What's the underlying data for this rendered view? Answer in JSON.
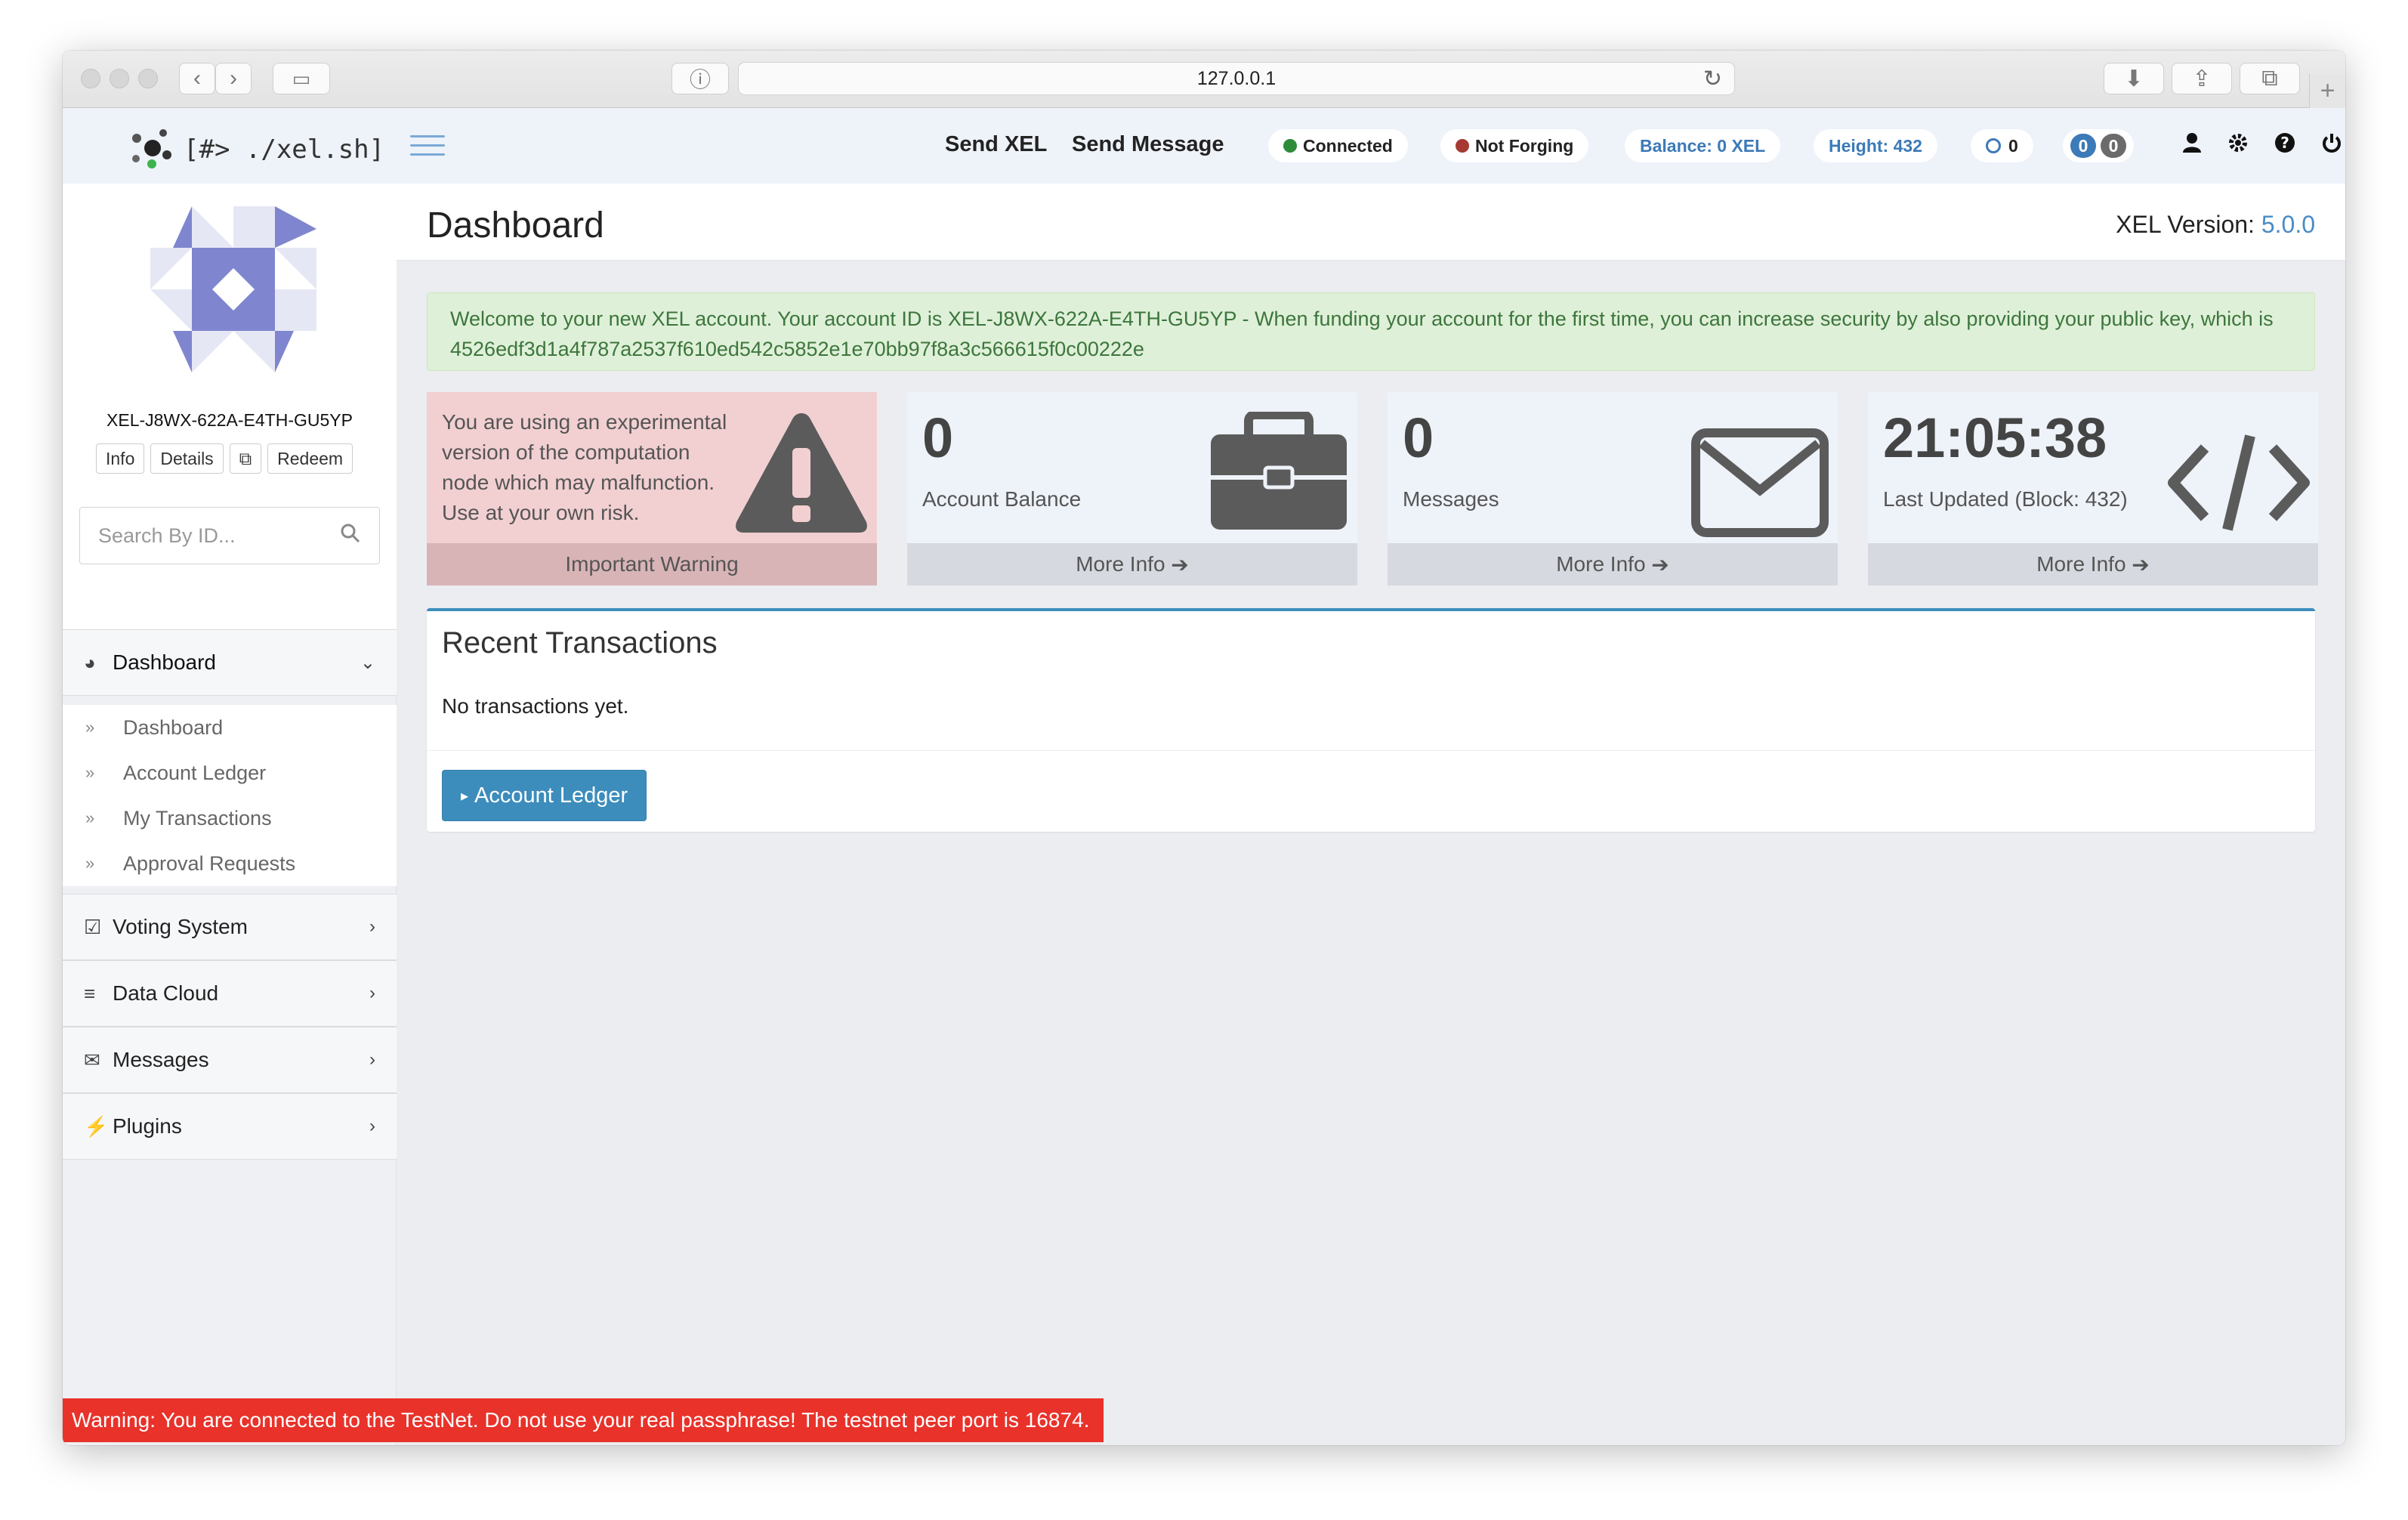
{
  "browser": {
    "url": "127.0.0.1"
  },
  "navbar": {
    "logo_text": "[#> ./xel.sh]",
    "send_xel": "Send XEL",
    "send_message": "Send Message",
    "connected": "Connected",
    "forging": "Not Forging",
    "balance": "Balance: 0 XEL",
    "height": "Height: 432",
    "pending_count": "0",
    "badge_left": "0",
    "badge_right": "0",
    "colors": {
      "connected": "#2e8b3a",
      "not_forging": "#a63a32",
      "badge_blue": "#3c7ab8",
      "badge_gray": "#6b6b6b"
    }
  },
  "sidebar": {
    "account_id": "XEL-J8WX-622A-E4TH-GU5YP",
    "buttons": [
      "Info",
      "Details",
      "⧉",
      "Redeem"
    ],
    "search_placeholder": "Search By ID...",
    "dashboard_head": "Dashboard",
    "dashboard_items": [
      "Dashboard",
      "Account Ledger",
      "My Transactions",
      "Approval Requests"
    ],
    "sections": [
      "Voting System",
      "Data Cloud",
      "Messages",
      "Plugins"
    ]
  },
  "content": {
    "title": "Dashboard",
    "version_label": "XEL Version:",
    "version_value": "5.0.0",
    "alert": "Welcome to your new XEL account. Your account ID is XEL-J8WX-622A-E4TH-GU5YP - When funding your account for the first time, you can increase security by also providing your public key, which is 4526edf3d1a4f787a2537f610ed542c5852e1e70bb97f8a3c566615f0c00222e",
    "warning_text": "You are using an experimental version of the computation node which may malfunction. Use at your own risk.",
    "warning_footer": "Important Warning",
    "balance_value": "0",
    "balance_label": "Account Balance",
    "messages_value": "0",
    "messages_label": "Messages",
    "time_value": "21:05:38",
    "time_label": "Last Updated (Block: 432)",
    "more_info": "More Info",
    "recent_title": "Recent Transactions",
    "no_tx": "No transactions yet.",
    "ledger_button": "Account Ledger"
  },
  "testnet_warning": "Warning: You are connected to the TestNet. Do not use your real passphrase! The testnet peer port is 16874."
}
